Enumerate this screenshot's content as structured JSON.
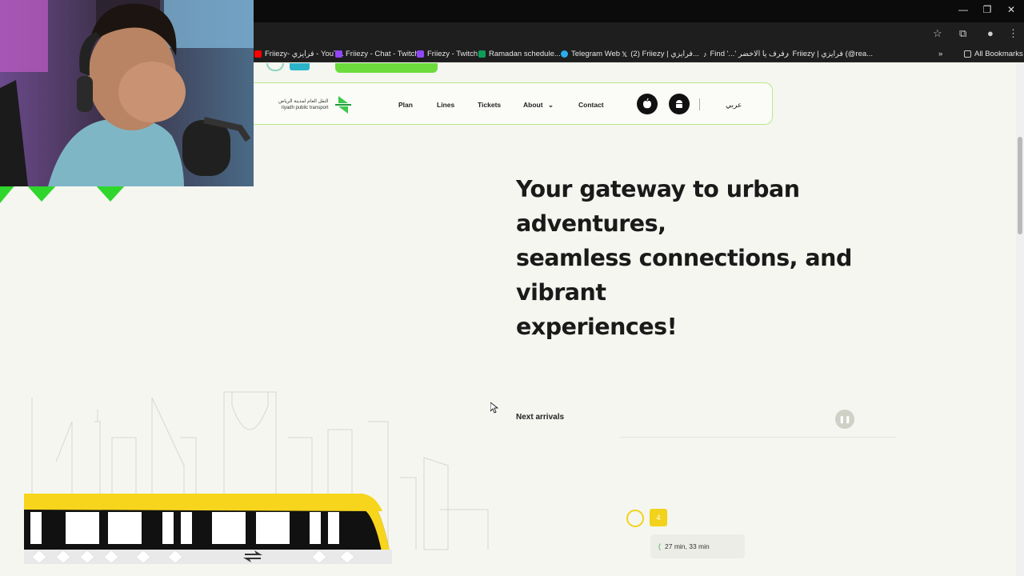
{
  "browser": {
    "bookmarks": [
      {
        "label": "Friiezy- فرايزي - YouT...",
        "color": "#ff0000"
      },
      {
        "label": "Friiezy - Chat - Twitch",
        "color": "#9146ff"
      },
      {
        "label": "Friiezy - Twitch",
        "color": "#9146ff"
      },
      {
        "label": "Ramadan schedule...",
        "color": "#0f9d58"
      },
      {
        "label": "Telegram Web",
        "color": "#2aabee"
      },
      {
        "label": "(2) Friiezy | فرايزي...",
        "color": "#ffffff"
      },
      {
        "label": "Find '...' رفرف يا الاخضر",
        "color": "#ffffff"
      },
      {
        "label": "Friiezy | فرايزي (@rea...",
        "color": "#ffffff"
      }
    ],
    "all_bookmarks": "All Bookmarks"
  },
  "site": {
    "logo": {
      "arabic": "النقل العام لمدينة الرياض",
      "english": "riyadh public transport"
    },
    "nav": [
      "Plan",
      "Lines",
      "Tickets",
      "About",
      "Contact"
    ],
    "language": "عربي",
    "hero_lines": [
      "Your gateway to urban adventures,",
      "seamless connections, and vibrant",
      "experiences!"
    ],
    "next_arrivals": "Next arrivals",
    "line_number": "4",
    "arrival_time": "27 min, 33 min",
    "accent_color": "#6cdc3c",
    "line_color": "#f2d21b"
  }
}
